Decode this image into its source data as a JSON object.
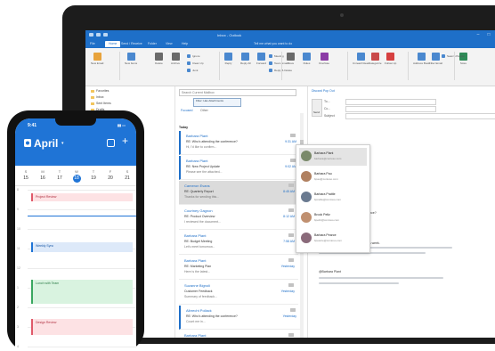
{
  "colors": {
    "outlook_blue": "#1e6fc8",
    "phone_header_blue": "#1f74d6",
    "event_red_bg": "#fde2e4",
    "event_green_bg": "#d9f3e0",
    "event_blue_bg": "#dde9f9"
  },
  "outlook": {
    "window_title": "Inbox - Outlook",
    "tabs": [
      "File",
      "Home",
      "Send / Receive",
      "Folder",
      "View",
      "Help"
    ],
    "active_tab_index": 1,
    "tell_me": "Tell me what you want to do",
    "ribbon": {
      "buttons": [
        "New Email",
        "New Items",
        "Delete",
        "Archive",
        "Reply",
        "Reply All",
        "Forward",
        "Move",
        "Rules",
        "OneNote",
        "Unread/ Read",
        "Categorize",
        "Follow Up",
        "Address Book",
        "Filter Email",
        "Store"
      ],
      "small_items": [
        "Ignore",
        "Clean Up",
        "Junk",
        "Meeting",
        "Team Email",
        "Reply & Delete",
        "Search People"
      ]
    },
    "folders": [
      "Favorites",
      "Inbox",
      "Sent Items",
      "Drafts",
      "Deleted Items"
    ],
    "message_list": {
      "search_placeholder": "Search Current Mailbox",
      "filter_tab": "Focused",
      "filter_tab_other": "Other",
      "filter_pill": "Filter: Has Attachments",
      "today_label": "Today",
      "messages": [
        {
          "from": "Barbara Plant",
          "subject": "RE: Who's attending the conference?",
          "preview": "Hi, I'd like to confirm...",
          "time": "9:31 AM",
          "unread": true,
          "selected": false
        },
        {
          "from": "Barbara Plant",
          "subject": "RE: New Project Update",
          "preview": "Please see the attached...",
          "time": "9:02 AM",
          "unread": true,
          "selected": false
        },
        {
          "from": "Cameron Evans",
          "subject": "RE: Quarterly Report",
          "preview": "Thanks for sending this...",
          "time": "8:45 AM",
          "unread": false,
          "selected": true
        },
        {
          "from": "Courtney Gagnon",
          "subject": "RE: Product Overview",
          "preview": "I reviewed the document...",
          "time": "8:12 AM",
          "unread": false,
          "selected": false
        },
        {
          "from": "Barbara Plant",
          "subject": "RE: Budget Meeting",
          "preview": "Let's meet tomorrow...",
          "time": "7:58 AM",
          "unread": false,
          "selected": false
        },
        {
          "from": "Barbara Plant",
          "subject": "RE: Marketing Plan",
          "preview": "Here is the latest...",
          "time": "Yesterday",
          "unread": false,
          "selected": false
        },
        {
          "from": "Suzanne Bignoli",
          "subject": "Customer Feedback",
          "preview": "Summary of feedback...",
          "time": "Yesterday",
          "unread": false,
          "selected": false
        },
        {
          "from": "Albrecht Pollack",
          "subject": "RE: Who's attending the conference?",
          "preview": "Count me in...",
          "time": "Yesterday",
          "unread": true,
          "selected": false
        },
        {
          "from": "Barbara Plant",
          "subject": "RE: Travel Plans",
          "preview": "Flight details below...",
          "time": "Yesterday",
          "unread": false,
          "selected": false
        }
      ]
    },
    "reading_pane": {
      "actions": "Discard   Pop Out",
      "send_label": "Send",
      "fields": [
        "To...",
        "Cc...",
        "Subject"
      ],
      "body": [
        "From: Suzanne Bignoli",
        "Sent: Thursday, October 15",
        "To: Barbara Plant",
        "Subject: Who's attending the conference?",
        "Hi Barbara,",
        "I'm at the conference for the team this week.",
        "@Barbara Plant"
      ],
      "mention_popup": [
        {
          "name": "Barbara Plant",
          "email": "barbara@contoso.com",
          "avatar_color": "#7a8a6a",
          "highlight": true
        },
        {
          "name": "Barbara Pau",
          "email": "bpau@contoso.com",
          "avatar_color": "#b08060",
          "highlight": false
        },
        {
          "name": "Barbara Prattle",
          "email": "bprattle@contoso.com",
          "avatar_color": "#6a7a90",
          "highlight": false
        },
        {
          "name": "Brook Peltz",
          "email": "bpeltz@contoso.com",
          "avatar_color": "#c09070",
          "highlight": false
        },
        {
          "name": "Barbara Pearce",
          "email": "bpearce@contoso.com",
          "avatar_color": "#8a6a7a",
          "highlight": false
        }
      ]
    }
  },
  "phone": {
    "status_time": "9:41",
    "month": "April",
    "days": [
      {
        "name": "S",
        "date": "15"
      },
      {
        "name": "M",
        "date": "16"
      },
      {
        "name": "T",
        "date": "17"
      },
      {
        "name": "W",
        "date": "18"
      },
      {
        "name": "T",
        "date": "19"
      },
      {
        "name": "F",
        "date": "20"
      },
      {
        "name": "S",
        "date": "21"
      }
    ],
    "selected_day_index": 3,
    "hours": [
      "8",
      "9",
      "10",
      "11",
      "12",
      "1",
      "2",
      "3",
      "4"
    ],
    "events": [
      {
        "title": "Project Review",
        "hour_offset": 0.2,
        "duration": 0.4,
        "color": "red"
      },
      {
        "title": "Weekly Sync",
        "hour_offset": 2.7,
        "duration": 0.5,
        "color": "blue"
      },
      {
        "title": "Lunch with Team",
        "hour_offset": 4.6,
        "duration": 1.2,
        "color": "green"
      },
      {
        "title": "Design Review",
        "hour_offset": 6.6,
        "duration": 0.8,
        "color": "red"
      }
    ]
  }
}
